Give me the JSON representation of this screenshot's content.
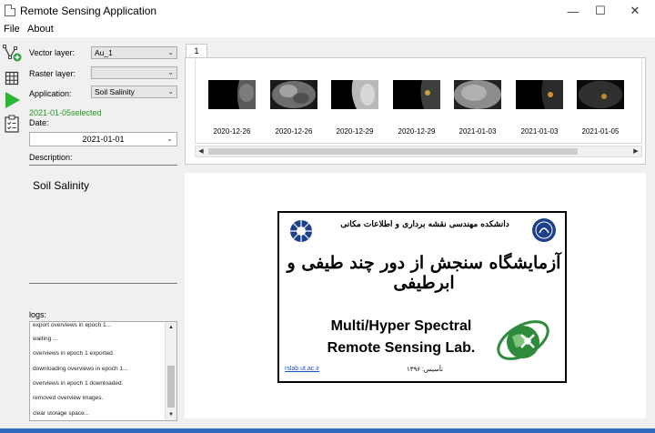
{
  "window": {
    "title": "Remote Sensing Application",
    "controls": {
      "minimize": "—",
      "maximize": "☐",
      "close": "✕"
    }
  },
  "menu": [
    "File",
    "About"
  ],
  "toolbar": {
    "icons": [
      "add-vector-icon",
      "grid-icon",
      "run-icon",
      "checklist-icon"
    ],
    "run_color": "#2bb534"
  },
  "left_panel": {
    "vector_layer_label": "Vector layer:",
    "vector_layer_value": "Au_1",
    "raster_layer_label": "Raster layer:",
    "raster_layer_value": "",
    "application_label": "Application:",
    "application_value": "Soil Salinity",
    "selected_status": "2021-01-05selected",
    "date_label": "Date:",
    "date_value": "2021-01-01",
    "description_label": "Description:",
    "description_text": "Soil Salinity",
    "logs_label": "logs:",
    "logs": [
      "export overviews in epoch 1...",
      "waiting ...",
      "overviews in epoch 1 exported.",
      "downloading overviews in epoch 1...",
      "overviews in epoch 1 downloaded.",
      "removed overview images.",
      "clear storage space..."
    ]
  },
  "tabs": [
    "1"
  ],
  "thumbnails": [
    {
      "date": "2020-12-26"
    },
    {
      "date": "2020-12-26"
    },
    {
      "date": "2020-12-29"
    },
    {
      "date": "2020-12-29"
    },
    {
      "date": "2021-01-03"
    },
    {
      "date": "2021-01-03"
    },
    {
      "date": "2021-01-05"
    }
  ],
  "lab_logo": {
    "persian_header": "دانشکده مهندسی نقشه برداری و اطلاعات مکانی",
    "persian_title": "آزمایشگاه سنجش از دور چند طیفی و ابرطیفی",
    "english_line1": "Multi/Hyper Spectral",
    "english_line2": "Remote Sensing Lab.",
    "url": "rslab.ut.ac.ir",
    "founded": "تأسیس: ۱۳۹۶"
  },
  "colors": {
    "status_green": "#1e9a1e",
    "taskbar_blue": "#2f6bbf"
  }
}
